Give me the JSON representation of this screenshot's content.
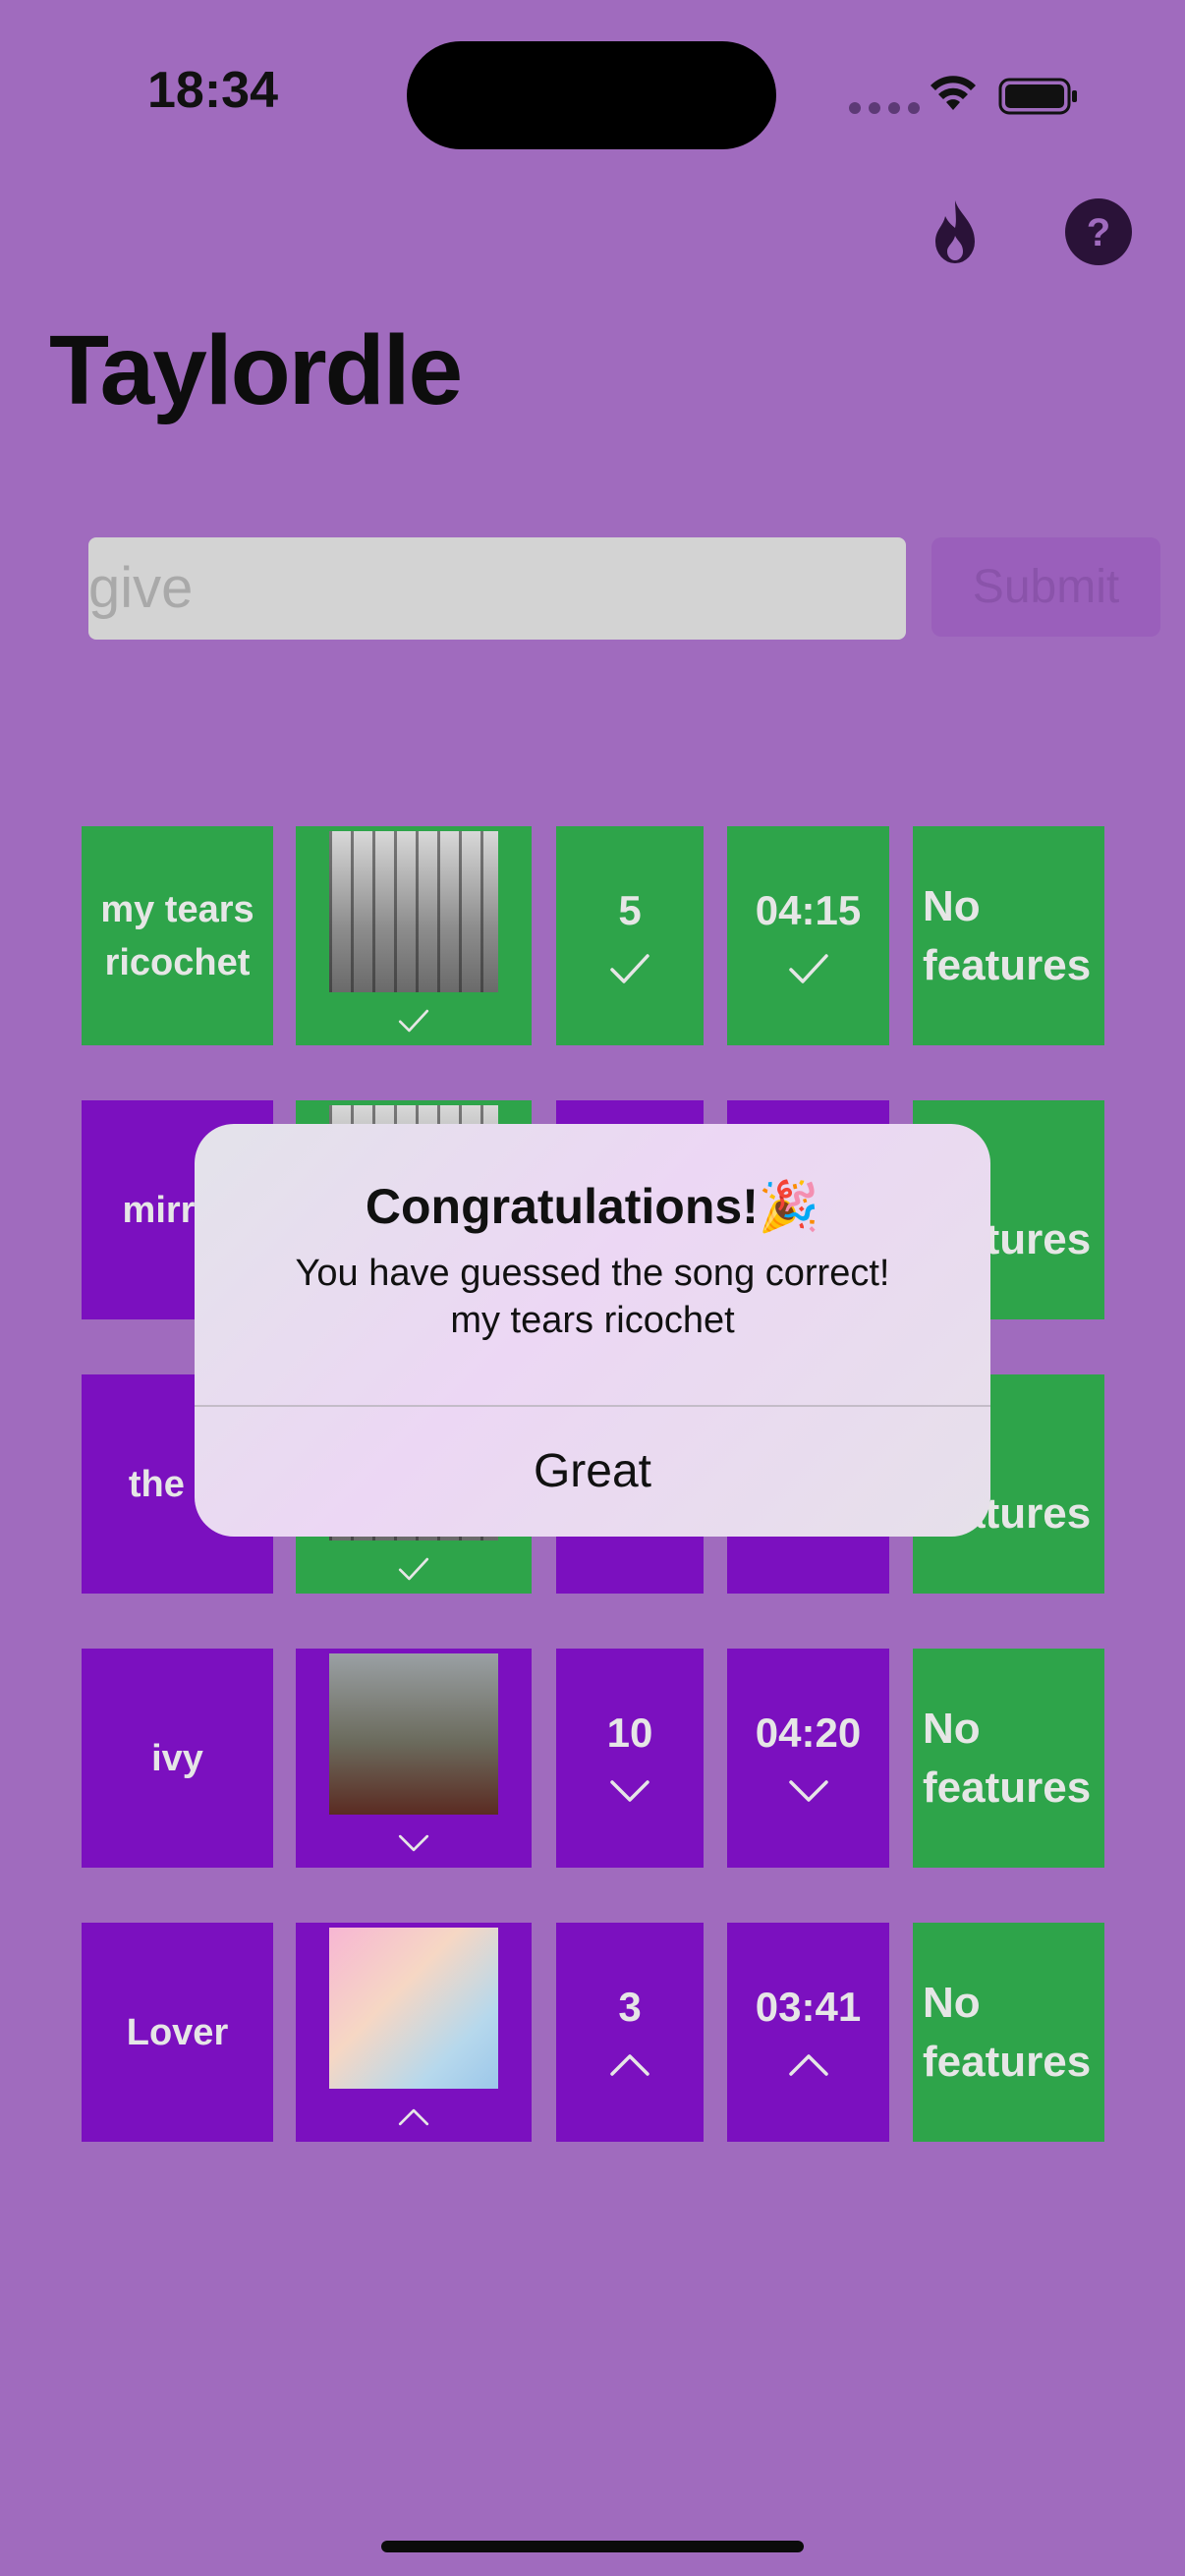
{
  "status": {
    "time": "18:34"
  },
  "app": {
    "title": "Taylordle"
  },
  "search": {
    "value": "give",
    "submit_label": "Submit"
  },
  "rows": [
    {
      "name": "my tears ricochet",
      "track": "5",
      "length": "04:15",
      "features": [
        "No",
        "features"
      ],
      "colors": [
        "green",
        "green",
        "green",
        "green",
        "green"
      ],
      "indicators": [
        "check",
        "check",
        "check"
      ]
    },
    {
      "name": "mirror",
      "track": "",
      "length": "",
      "features": [
        "No",
        "features"
      ],
      "colors": [
        "purple",
        "green",
        "purple",
        "purple",
        "green"
      ],
      "indicators": [
        "",
        "",
        ""
      ]
    },
    {
      "name": "the la",
      "track": "",
      "length": "",
      "features": [
        "No",
        "features"
      ],
      "colors": [
        "purple",
        "green",
        "purple",
        "purple",
        "green"
      ],
      "indicators": [
        "check",
        "",
        ""
      ]
    },
    {
      "name": "ivy",
      "track": "10",
      "length": "04:20",
      "features": [
        "No",
        "features"
      ],
      "colors": [
        "purple",
        "purple",
        "purple",
        "purple",
        "green"
      ],
      "indicators": [
        "down",
        "down",
        "down"
      ]
    },
    {
      "name": "Lover",
      "track": "3",
      "length": "03:41",
      "features": [
        "No",
        "features"
      ],
      "colors": [
        "purple",
        "purple",
        "purple",
        "purple",
        "green"
      ],
      "indicators": [
        "up",
        "up",
        "up"
      ]
    }
  ],
  "alert": {
    "title": "Congratulations!🎉",
    "message_line1": "You have guessed the song correct!",
    "message_line2": "my tears ricochet",
    "button": "Great"
  },
  "colors": {
    "background": "#a06bbe",
    "green": "#2ea44a",
    "purple": "#7b10bf"
  },
  "icons": {
    "streak": "flame-icon",
    "help": "help-icon"
  }
}
